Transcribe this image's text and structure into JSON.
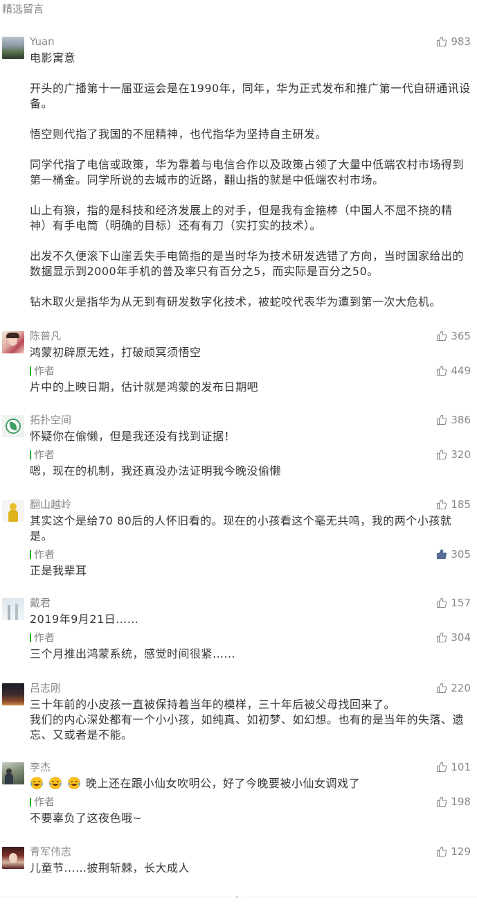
{
  "section_title": "精选留言",
  "icons": {
    "like": "thumbs-up-icon",
    "emoji": "face-with-tears-of-joy"
  },
  "colors": {
    "background": "#ffffff",
    "text": "#353535",
    "meta": "#888888",
    "author_marker": "#1aad19",
    "liked_icon": "#576b95"
  },
  "comments": [
    {
      "name": "Yuan",
      "likes": 983,
      "liked": false,
      "content": [
        [
          "电影寓意"
        ],
        [
          "开头的广播第十一届亚运会是在1990年，同年，华为正式发布和推广第一代自研通讯设",
          "备。"
        ],
        [
          "悟空则代指了我国的不屈精神，也代指华为坚持自主研发。"
        ],
        [
          "同学代指了电信或政策，华为靠着与电信合作以及政策占领了大量中低端农村市场得到",
          "第一桶金。同学所说的去城市的近路，翻山指的就是中低端农村市场。"
        ],
        [
          "山上有狼，指的是科技和经济发展上的对手，但是我有金箍棒（中国人不屈不挠的精",
          "神）有手电筒（明确的目标）还有有刀（实打实的技术）。"
        ],
        [
          "出发不久便滚下山崖丢失手电筒指的是当时华为技术研发选错了方向，当时国家给出的",
          "数据显示到2000年手机的普及率只有百分之5，而实际是百分之50。"
        ],
        [
          "钻木取火是指华为从无到有研发数字化技术，被蛇咬代表华为遭到第一次大危机。"
        ]
      ]
    },
    {
      "name": "陈普凡",
      "likes": 365,
      "liked": false,
      "content": [
        [
          "鸿蒙初辟原无姓，打破顽冥须悟空"
        ]
      ],
      "reply": {
        "label": "作者",
        "likes": 449,
        "liked": false,
        "content": [
          [
            "片中的上映日期，估计就是鸿蒙的发布日期吧"
          ]
        ]
      }
    },
    {
      "name": "拓扑空间",
      "likes": 386,
      "liked": false,
      "content": [
        [
          "怀疑你在偷懒，但是我还没有找到证据！"
        ]
      ],
      "reply": {
        "label": "作者",
        "likes": 320,
        "liked": false,
        "content": [
          [
            "嗯，现在的机制，我还真没办法证明我今晚没偷懒"
          ]
        ]
      }
    },
    {
      "name": "翻山越岭",
      "likes": 185,
      "liked": false,
      "content": [
        [
          "其实这个是给70 80后的人怀旧看的。现在的小孩看这个毫无共鸣，我的两个小孩就",
          "是。"
        ]
      ],
      "reply": {
        "label": "作者",
        "likes": 305,
        "liked": true,
        "content": [
          [
            "正是我辈耳"
          ]
        ]
      }
    },
    {
      "name": "戴君",
      "likes": 157,
      "liked": false,
      "content": [
        [
          "2019年9月21日……"
        ]
      ],
      "reply": {
        "label": "作者",
        "likes": 304,
        "liked": false,
        "content": [
          [
            "三个月推出鸿蒙系统，感觉时间很紧……"
          ]
        ]
      }
    },
    {
      "name": "吕志刚",
      "likes": 220,
      "liked": false,
      "content": [
        [
          "三十年前的小皮孩一直被保持着当年的模样，三十年后被父母找回来了。",
          "我们的内心深处都有一个小小孩，如纯真、如初梦、如幻想。也有的是当年的失落、遗",
          "忘、又或者是不能。"
        ]
      ]
    },
    {
      "name": "李杰",
      "likes": 101,
      "liked": false,
      "leading_emoji": [
        "face-with-tears-of-joy",
        "face-with-tears-of-joy",
        "face-with-tears-of-joy"
      ],
      "content": [
        [
          "晚上还在跟小仙女吹明公，好了今晚要被小仙女调戏了"
        ]
      ],
      "reply": {
        "label": "作者",
        "likes": 198,
        "liked": false,
        "content": [
          [
            "不要辜负了这夜色哦~"
          ]
        ]
      }
    },
    {
      "name": "青军伟志",
      "likes": 129,
      "liked": false,
      "content": [
        [
          "儿童节……披荆斩棘，长大成人"
        ]
      ]
    }
  ]
}
